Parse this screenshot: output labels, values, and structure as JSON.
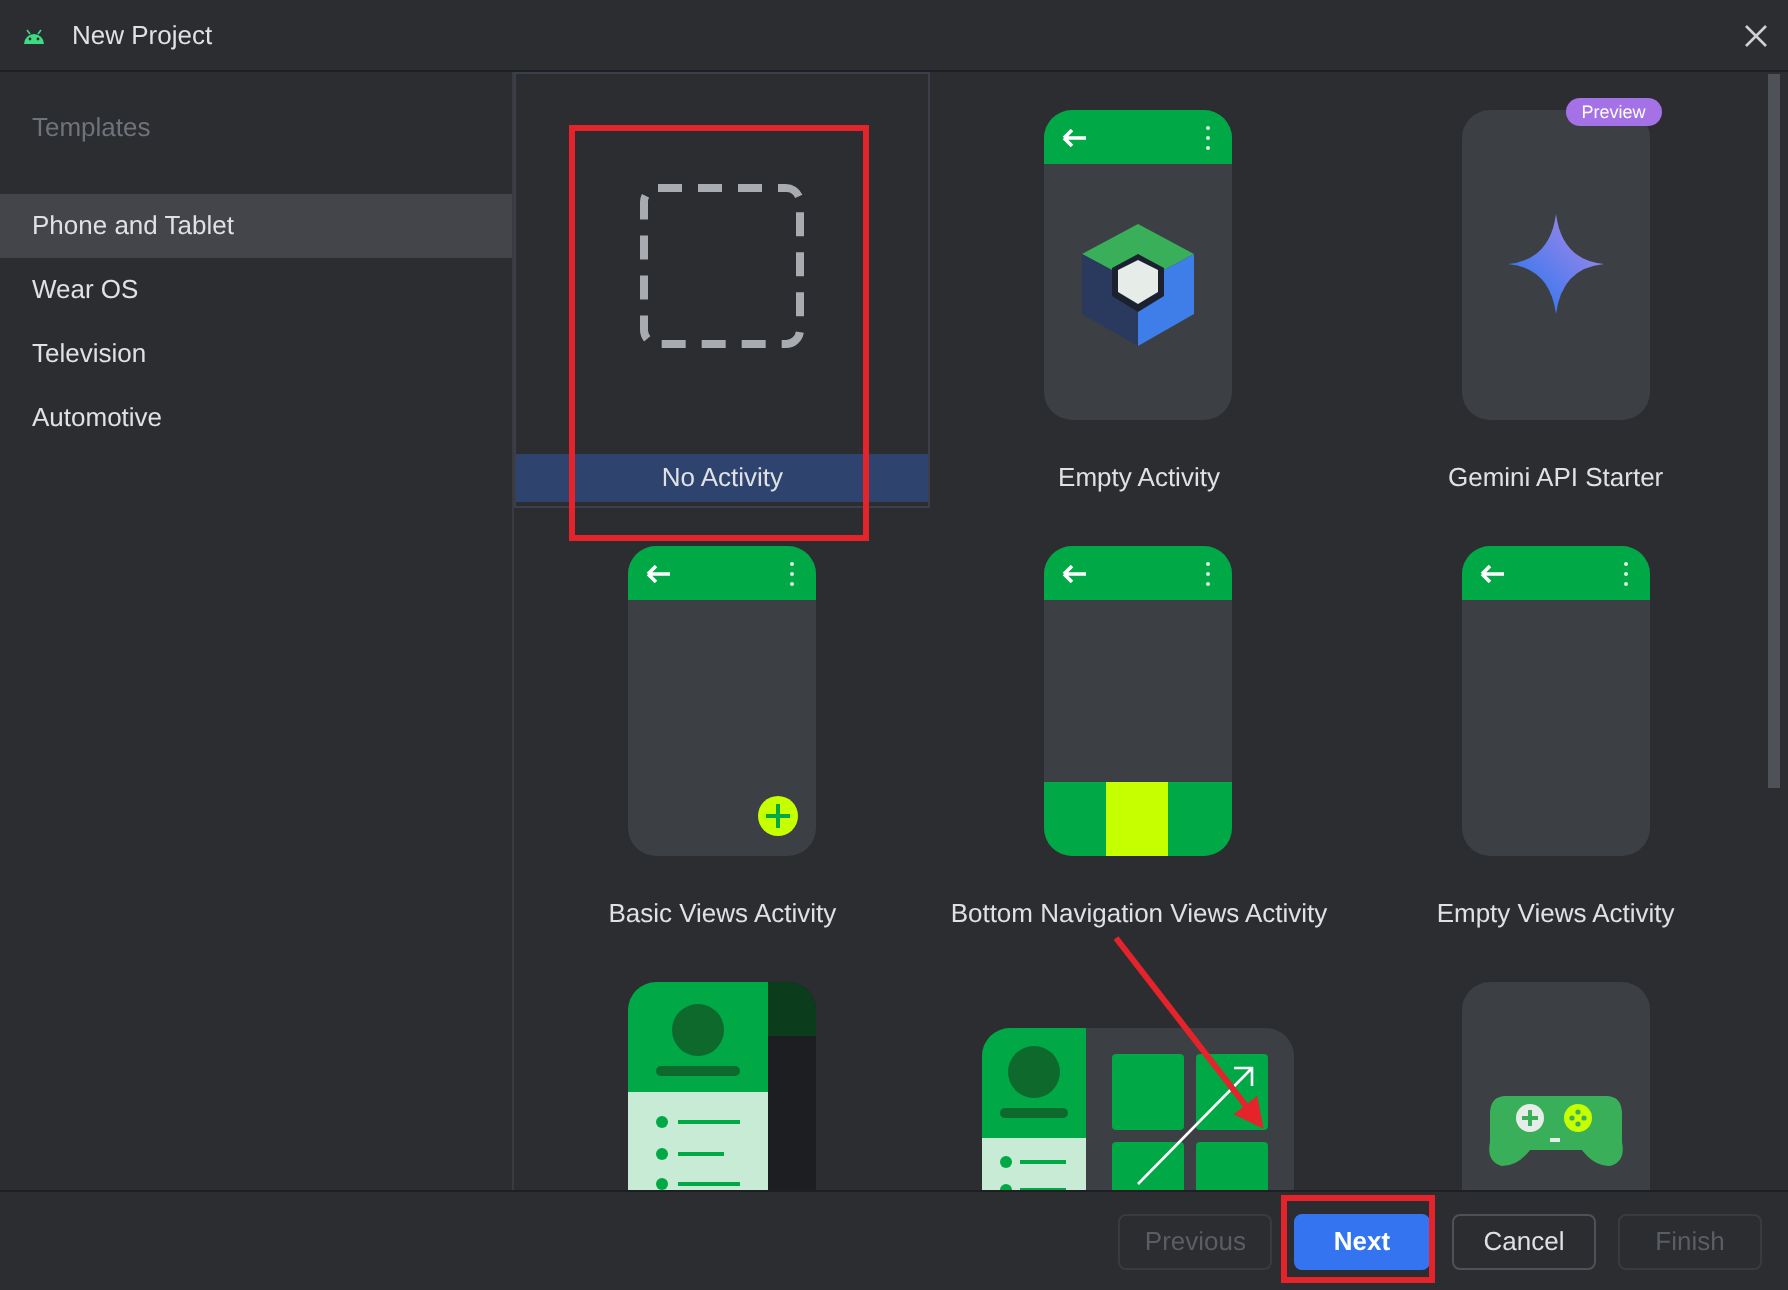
{
  "window": {
    "title": "New Project"
  },
  "sidebar": {
    "heading": "Templates",
    "items": [
      {
        "label": "Phone and Tablet",
        "selected": true
      },
      {
        "label": "Wear OS",
        "selected": false
      },
      {
        "label": "Television",
        "selected": false
      },
      {
        "label": "Automotive",
        "selected": false
      }
    ]
  },
  "templates": [
    {
      "kind": "none",
      "label": "No Activity",
      "selected": true
    },
    {
      "kind": "compose",
      "label": "Empty Activity",
      "selected": false
    },
    {
      "kind": "gemini",
      "label": "Gemini API Starter",
      "badge": "Preview",
      "selected": false
    },
    {
      "kind": "basic",
      "label": "Basic Views Activity",
      "selected": false
    },
    {
      "kind": "bottom_nav",
      "label": "Bottom Navigation Views Activity",
      "selected": false
    },
    {
      "kind": "views",
      "label": "Empty Views Activity",
      "selected": false
    },
    {
      "kind": "drawer",
      "selected": false
    },
    {
      "kind": "responsive",
      "selected": false
    },
    {
      "kind": "game",
      "selected": false
    }
  ],
  "buttons": [
    {
      "label": "Previous",
      "kind": "secondary",
      "disabled": true
    },
    {
      "label": "Next",
      "kind": "primary",
      "disabled": false
    },
    {
      "label": "Cancel",
      "kind": "secondary",
      "disabled": false
    },
    {
      "label": "Finish",
      "kind": "secondary",
      "disabled": true
    }
  ]
}
